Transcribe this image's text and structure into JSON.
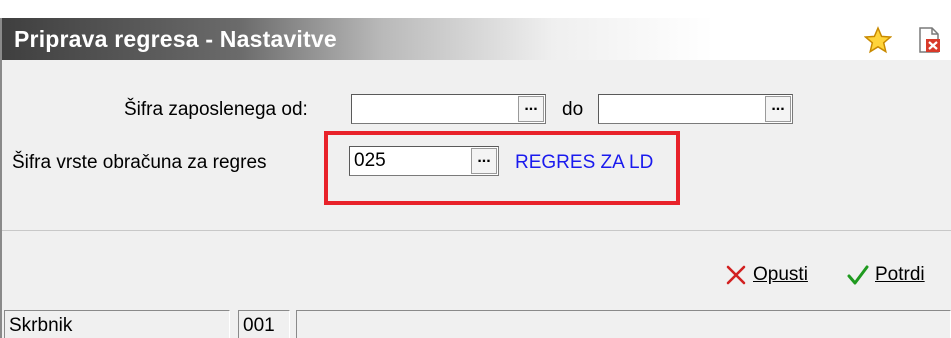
{
  "window": {
    "title": "Priprava regresa - Nastavitve"
  },
  "form": {
    "sifra_zaposlenega_label": "Šifra zaposlenega od:",
    "sifra_zaposlenega_od_value": "",
    "do_label": "do",
    "sifra_zaposlenega_do_value": "",
    "vrsta_obracuna_label": "Šifra vrste obračuna za regres",
    "vrsta_obracuna_value": "025",
    "vrsta_obracuna_desc": "REGRES ZA LD",
    "browse_label": "..."
  },
  "buttons": {
    "cancel_label": "Opusti",
    "confirm_label": "Potrdi"
  },
  "statusbar": {
    "user": "Skrbnik",
    "code": "001",
    "message": ""
  },
  "colors": {
    "highlight": "#e8222a",
    "description_text": "#1a1aee"
  }
}
